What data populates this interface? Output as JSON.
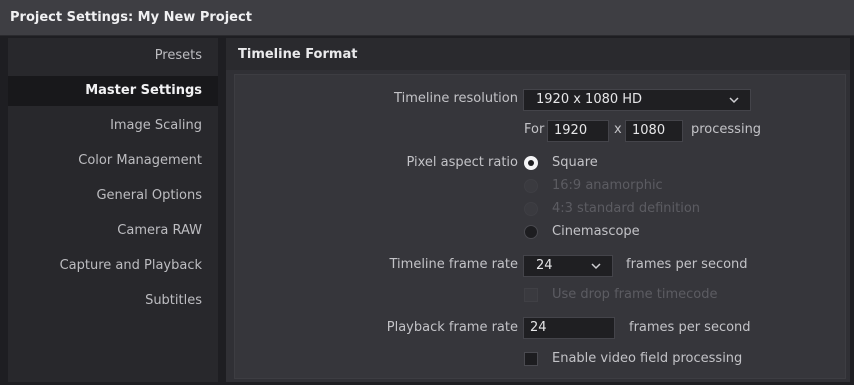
{
  "window": {
    "title": "Project Settings:  My New Project"
  },
  "sidebar": {
    "items": [
      {
        "label": "Presets",
        "selected": false
      },
      {
        "label": "Master Settings",
        "selected": true
      },
      {
        "label": "Image Scaling",
        "selected": false
      },
      {
        "label": "Color Management",
        "selected": false
      },
      {
        "label": "General Options",
        "selected": false
      },
      {
        "label": "Camera RAW",
        "selected": false
      },
      {
        "label": "Capture and Playback",
        "selected": false
      },
      {
        "label": "Subtitles",
        "selected": false
      }
    ]
  },
  "section": {
    "title": "Timeline Format"
  },
  "timeline_resolution": {
    "label": "Timeline resolution",
    "value": "1920 x 1080 HD",
    "for_label": "For",
    "width": "1920",
    "x_label": "x",
    "height": "1080",
    "suffix": "processing"
  },
  "pixel_aspect": {
    "label": "Pixel aspect ratio",
    "options": [
      {
        "label": "Square",
        "state": "selected"
      },
      {
        "label": "16:9 anamorphic",
        "state": "disabled"
      },
      {
        "label": "4:3 standard definition",
        "state": "disabled"
      },
      {
        "label": "Cinemascope",
        "state": "enabled"
      }
    ]
  },
  "timeline_frame_rate": {
    "label": "Timeline frame rate",
    "value": "24",
    "suffix": "frames per second"
  },
  "drop_frame": {
    "label": "Use drop frame timecode",
    "checked": false,
    "disabled": true
  },
  "playback_frame_rate": {
    "label": "Playback frame rate",
    "value": "24",
    "suffix": "frames per second"
  },
  "video_field": {
    "label": "Enable video field processing",
    "checked": false,
    "disabled": false
  },
  "colors": {
    "titlebar": "#3e3e43",
    "selected_item": "#18181b",
    "panel": "#36363b"
  }
}
